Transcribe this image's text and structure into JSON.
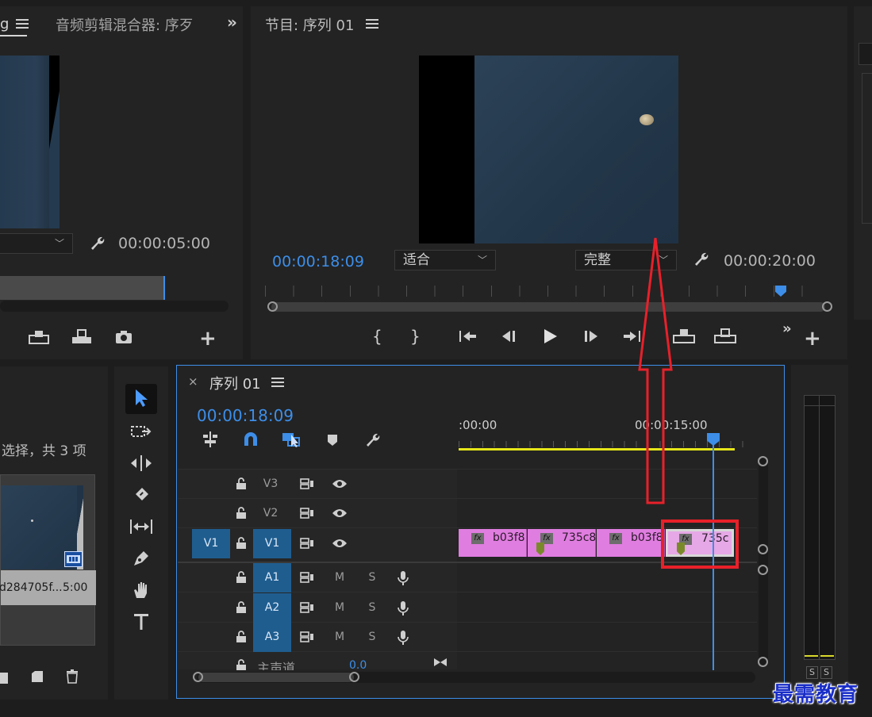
{
  "source_panel": {
    "tab_partial": "g",
    "tab_audio_mixer": "音频剪辑混合器: 序歹",
    "timecode_end": "00:00:05:00"
  },
  "program_panel": {
    "title": "节目: 序列 01",
    "timecode_current": "00:00:18:09",
    "fit_label": "适合",
    "quality_label": "完整",
    "timecode_duration": "00:00:20:00"
  },
  "project_panel": {
    "selection_info": "选择，共 3 项",
    "clip_name": "d284705f...",
    "clip_duration": "5:00"
  },
  "timeline": {
    "title": "序列 01",
    "timecode": "00:00:18:09",
    "ruler_start": ":00:00",
    "ruler_mid": "00:00:15:00",
    "tracks": {
      "v3": "V3",
      "v2": "V2",
      "v1": "V1",
      "v1_source": "V1",
      "a1": "A1",
      "a2": "A2",
      "a3": "A3",
      "mute": "M",
      "solo": "S",
      "master": "主声道",
      "master_value": "0.0"
    },
    "clips": [
      {
        "name": "b03f8"
      },
      {
        "name": "735c8"
      },
      {
        "name": "b03f8"
      },
      {
        "name": "735c"
      }
    ],
    "fx_label": "fx"
  },
  "meters": {
    "solo_left": "S",
    "solo_right": "S"
  },
  "watermark": "最需教育",
  "colors": {
    "accent_blue": "#3d8ee8",
    "clip_pink": "#e07de0",
    "annotation_red": "#e8202a",
    "watermark_blue": "#1a2ec8",
    "work_area_yellow": "#e6e61a"
  }
}
